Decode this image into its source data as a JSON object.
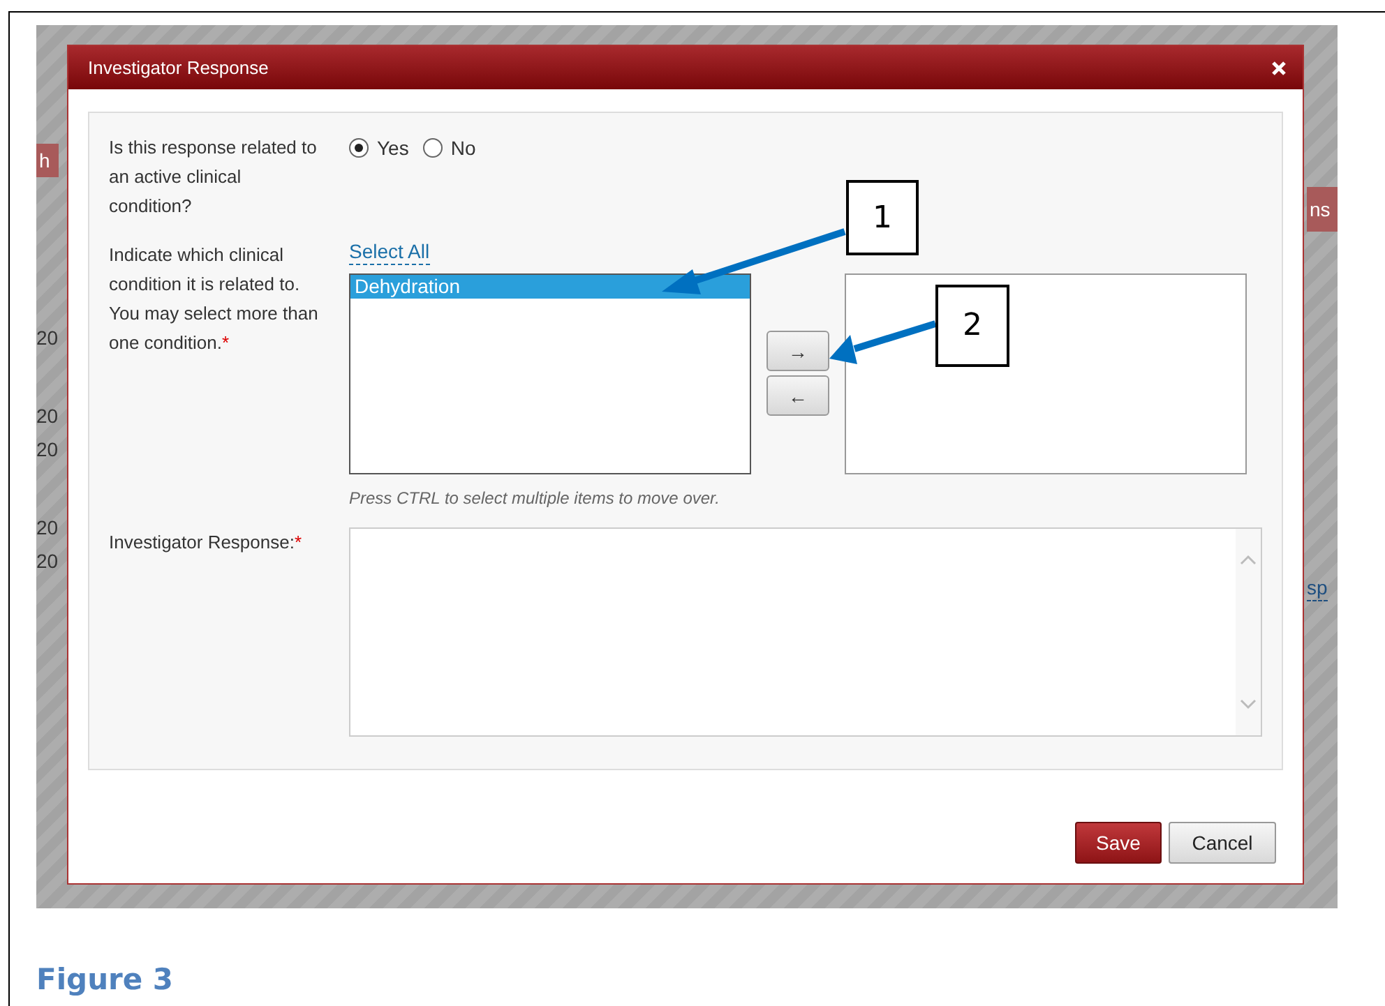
{
  "background_fragments": {
    "left": [
      {
        "text": "h",
        "kind": "button"
      },
      {
        "text": "20",
        "kind": "text"
      },
      {
        "text": "20",
        "kind": "text"
      },
      {
        "text": "20",
        "kind": "text"
      },
      {
        "text": "20",
        "kind": "text"
      },
      {
        "text": "20",
        "kind": "text"
      }
    ],
    "right": [
      {
        "text": "ns",
        "kind": "band"
      },
      {
        "text": "sp",
        "kind": "link"
      }
    ]
  },
  "dialog": {
    "title": "Investigator Response",
    "question": {
      "label": "Is this response related to an active clinical condition?",
      "options": [
        {
          "label": "Yes",
          "selected": true
        },
        {
          "label": "No",
          "selected": false
        }
      ]
    },
    "conditions": {
      "label": "Indicate which clinical condition it is related to. You may select more than one condition.",
      "required_mark": "*",
      "select_all": "Select All",
      "available": [
        {
          "label": "Dehydration",
          "selected": true
        }
      ],
      "move_right": "→",
      "move_left": "←",
      "hint": "Press CTRL to select multiple items to move over."
    },
    "response": {
      "label": "Investigator Response:",
      "required_mark": "*"
    },
    "buttons": [
      {
        "label": "Save",
        "kind": "primary"
      },
      {
        "label": "Cancel",
        "kind": "secondary"
      }
    ]
  },
  "callouts": [
    {
      "label": "1"
    },
    {
      "label": "2"
    }
  ],
  "caption": "Figure 3"
}
